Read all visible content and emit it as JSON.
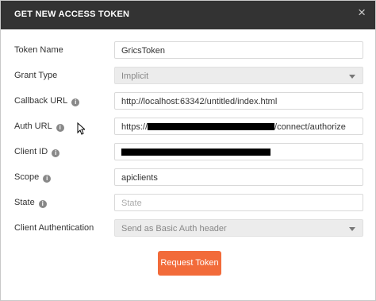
{
  "dialog": {
    "title": "GET NEW ACCESS TOKEN",
    "close_glyph": "×"
  },
  "form": {
    "token_name": {
      "label": "Token Name",
      "value": "GricsToken"
    },
    "grant_type": {
      "label": "Grant Type",
      "value": "Implicit"
    },
    "callback_url": {
      "label": "Callback URL",
      "value": "http://localhost:63342/untitled/index.html"
    },
    "auth_url": {
      "label": "Auth URL",
      "prefix": "https://",
      "suffix": "/connect/authorize"
    },
    "client_id": {
      "label": "Client ID"
    },
    "scope": {
      "label": "Scope",
      "value": "apiclients"
    },
    "state": {
      "label": "State",
      "placeholder": "State"
    },
    "client_authentication": {
      "label": "Client Authentication",
      "value": "Send as Basic Auth header"
    }
  },
  "actions": {
    "request_token": "Request Token"
  },
  "icons": {
    "info": "info-icon",
    "close": "close-icon",
    "dropdown": "chevron-down-icon"
  },
  "colors": {
    "titlebar": "#333333",
    "accent": "#f26b3a"
  }
}
